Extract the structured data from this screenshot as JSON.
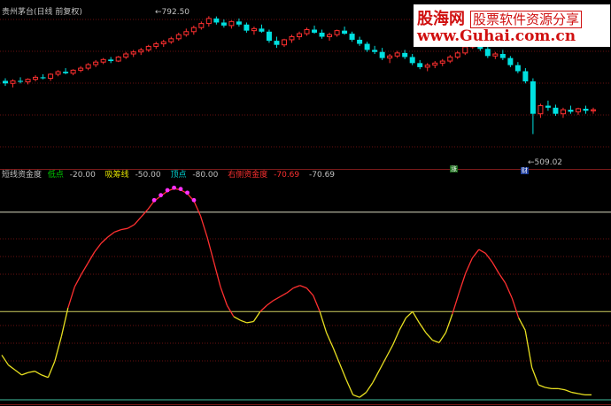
{
  "top_panel": {
    "title": "贵州茅台(日线 前复权)",
    "high_label": "←792.50",
    "low_label": "←509.02",
    "tag_green": "涨",
    "tag_blue": "财"
  },
  "indicator_bar": {
    "name": "短线资金度",
    "items": [
      {
        "label": "低点",
        "value": "-20.00",
        "color": "#00d000"
      },
      {
        "label": "吸筹线",
        "value": "-50.00",
        "color": "#e0e000"
      },
      {
        "label": "顶点",
        "value": "-80.00",
        "color": "#00d0d0"
      },
      {
        "label": "右侧资金度",
        "value": "-70.69",
        "color": "#ff3030"
      },
      {
        "label": "",
        "value": "-70.69",
        "color": "#c0c0c0"
      }
    ]
  },
  "watermark": {
    "brand": "股海网",
    "slogan": "股票软件资源分享",
    "url": "www.Guhai.com.cn"
  },
  "colors": {
    "up": "#ff3030",
    "down": "#00e0e0",
    "line_high": "#ff3030",
    "line_low": "#e8e020",
    "dots": "#ff30ff",
    "grid": "#6a1010"
  },
  "chart_data": [
    {
      "type": "candlestick",
      "title": "贵州茅台(日线 前复权)",
      "annotations": [
        "792.50",
        "509.02"
      ],
      "ohlc": [
        [
          665,
          670,
          655,
          660
        ],
        [
          660,
          668,
          652,
          665
        ],
        [
          665,
          672,
          660,
          663
        ],
        [
          663,
          670,
          658,
          668
        ],
        [
          668,
          676,
          664,
          672
        ],
        [
          672,
          678,
          668,
          670
        ],
        [
          670,
          680,
          665,
          678
        ],
        [
          678,
          686,
          674,
          683
        ],
        [
          683,
          690,
          678,
          680
        ],
        [
          680,
          688,
          676,
          686
        ],
        [
          686,
          694,
          682,
          690
        ],
        [
          690,
          700,
          686,
          697
        ],
        [
          697,
          706,
          692,
          702
        ],
        [
          702,
          710,
          698,
          707
        ],
        [
          707,
          712,
          700,
          704
        ],
        [
          704,
          714,
          702,
          712
        ],
        [
          712,
          722,
          708,
          718
        ],
        [
          718,
          726,
          712,
          722
        ],
        [
          722,
          730,
          716,
          726
        ],
        [
          726,
          736,
          722,
          733
        ],
        [
          733,
          742,
          728,
          738
        ],
        [
          738,
          746,
          732,
          742
        ],
        [
          742,
          752,
          738,
          748
        ],
        [
          748,
          760,
          744,
          756
        ],
        [
          756,
          768,
          752,
          762
        ],
        [
          762,
          774,
          756,
          770
        ],
        [
          770,
          782,
          766,
          778
        ],
        [
          778,
          792.5,
          772,
          788
        ],
        [
          788,
          792,
          776,
          780
        ],
        [
          780,
          786,
          770,
          774
        ],
        [
          774,
          784,
          768,
          782
        ],
        [
          782,
          788,
          772,
          776
        ],
        [
          776,
          780,
          760,
          764
        ],
        [
          764,
          772,
          756,
          768
        ],
        [
          768,
          776,
          760,
          762
        ],
        [
          762,
          766,
          740,
          744
        ],
        [
          744,
          752,
          730,
          736
        ],
        [
          736,
          748,
          732,
          746
        ],
        [
          746,
          756,
          740,
          752
        ],
        [
          752,
          762,
          746,
          758
        ],
        [
          758,
          770,
          754,
          766
        ],
        [
          766,
          774,
          758,
          760
        ],
        [
          760,
          766,
          748,
          752
        ],
        [
          752,
          760,
          744,
          756
        ],
        [
          756,
          766,
          752,
          764
        ],
        [
          764,
          772,
          756,
          758
        ],
        [
          758,
          762,
          742,
          746
        ],
        [
          746,
          752,
          734,
          738
        ],
        [
          738,
          742,
          722,
          726
        ],
        [
          726,
          734,
          718,
          722
        ],
        [
          722,
          730,
          706,
          710
        ],
        [
          710,
          718,
          700,
          714
        ],
        [
          714,
          724,
          710,
          720
        ],
        [
          720,
          726,
          708,
          712
        ],
        [
          712,
          718,
          696,
          700
        ],
        [
          700,
          706,
          688,
          692
        ],
        [
          692,
          700,
          684,
          696
        ],
        [
          696,
          704,
          690,
          700
        ],
        [
          700,
          708,
          694,
          704
        ],
        [
          704,
          716,
          700,
          712
        ],
        [
          712,
          724,
          708,
          720
        ],
        [
          720,
          736,
          716,
          732
        ],
        [
          732,
          744,
          728,
          740
        ],
        [
          740,
          746,
          724,
          728
        ],
        [
          728,
          732,
          710,
          714
        ],
        [
          714,
          722,
          708,
          718
        ],
        [
          718,
          726,
          706,
          710
        ],
        [
          710,
          714,
          692,
          696
        ],
        [
          696,
          702,
          680,
          684
        ],
        [
          684,
          690,
          660,
          664
        ],
        [
          664,
          670,
          560,
          600
        ],
        [
          600,
          620,
          592,
          616
        ],
        [
          616,
          626,
          606,
          612
        ],
        [
          612,
          618,
          596,
          600
        ],
        [
          600,
          612,
          592,
          608
        ],
        [
          608,
          616,
          600,
          604
        ],
        [
          604,
          612,
          598,
          610
        ],
        [
          610,
          616,
          600,
          606
        ],
        [
          606,
          612,
          600,
          608
        ]
      ]
    },
    {
      "type": "line",
      "title": "短线资金度",
      "series": [
        {
          "name": "短线资金度",
          "values": [
            -50,
            -58,
            -62,
            -66,
            -64,
            -63,
            -66,
            -68,
            -55,
            -35,
            -12,
            5,
            15,
            24,
            33,
            40,
            45,
            49,
            51,
            52,
            55,
            61,
            67,
            74,
            78,
            82,
            84,
            83,
            80,
            74,
            62,
            45,
            25,
            5,
            -10,
            -19,
            -22,
            -24,
            -23,
            -15,
            -10,
            -6,
            -3,
            0,
            4,
            6,
            4,
            -2,
            -15,
            -32,
            -44,
            -57,
            -70,
            -82,
            -84,
            -80,
            -72,
            -62,
            -52,
            -42,
            -30,
            -20,
            -15,
            -24,
            -32,
            -38,
            -40,
            -32,
            -17,
            0,
            16,
            28,
            35,
            32,
            25,
            16,
            8,
            -4,
            -20,
            -30,
            -60,
            -74,
            -76,
            -77,
            -77,
            -78,
            -80,
            -81,
            -82,
            -82
          ]
        }
      ],
      "reference_lines": [
        -20,
        -50,
        -80
      ],
      "ylim": [
        -86,
        92
      ]
    }
  ]
}
